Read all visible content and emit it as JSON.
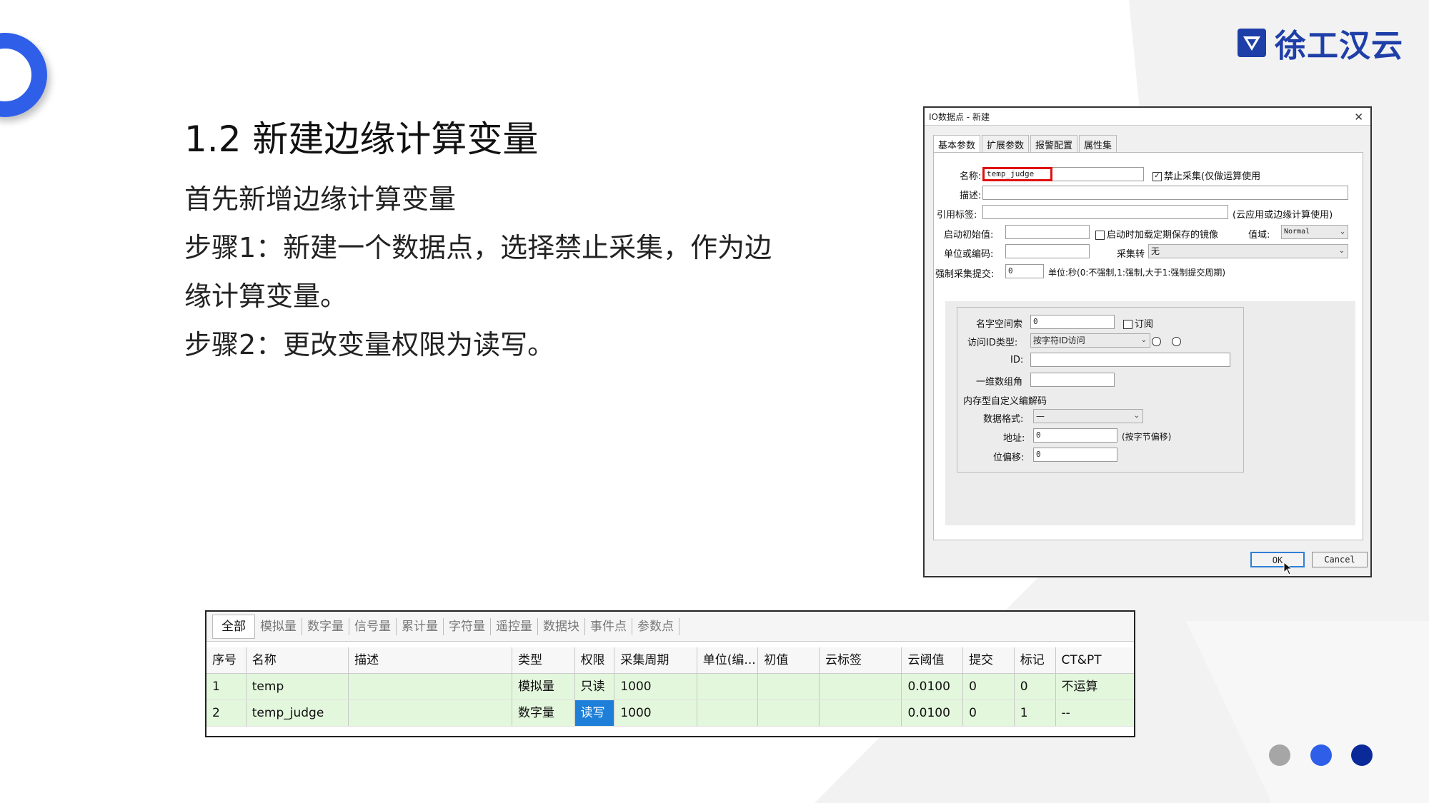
{
  "brand": {
    "logo_text": "徐工汉云",
    "accent": "#2f5fe8",
    "logo_color": "#1f3fa8"
  },
  "slide": {
    "title": "1.2 新建边缘计算变量",
    "lines": [
      "首先新增边缘计算变量",
      "步骤1：新建一个数据点，选择禁止采集，作为边",
      "缘计算变量。",
      "步骤2：更改变量权限为读写。"
    ]
  },
  "dialog": {
    "title": "IO数据点 - 新建",
    "tabs": [
      "基本参数",
      "扩展参数",
      "报警配置",
      "属性集"
    ],
    "fields": {
      "name_label": "名称:",
      "name_value": "temp_judge",
      "forbid_collect": "禁止采集(仅做运算使用",
      "desc_label": "描述:",
      "ref_tag_label": "引用标签:",
      "ref_tag_hint": "(云应用或边缘计算使用)",
      "init_value_label": "启动初始值:",
      "load_image_label": "启动时加载定期保存的镜像",
      "range_label": "值域:",
      "range_value": "Normal",
      "unit_label": "单位或编码:",
      "collect_convert_label": "采集转",
      "collect_convert_value": "无",
      "force_label": "强制采集提交:",
      "force_value": "0",
      "force_hint": "单位:秒(0:不强制,1:强制,大于1:强制提交周期)",
      "ns_index_label": "名字空间索",
      "ns_index_value": "0",
      "subscribe_label": "订阅",
      "access_type_label": "访问ID类型:",
      "access_type_value": "按字符ID访问",
      "id_label": "ID:",
      "array_label": "一维数组角",
      "custom_codec_label": "内存型自定义编解码",
      "data_format_label": "数据格式:",
      "data_format_value": "—",
      "address_label": "地址:",
      "address_value": "0",
      "address_hint": "(按字节偏移)",
      "bit_offset_label": "位偏移:",
      "bit_offset_value": "0"
    },
    "ok": "OK",
    "cancel": "Cancel",
    "close": "✕"
  },
  "table": {
    "tabs": [
      "全部",
      "模拟量",
      "数字量",
      "信号量",
      "累计量",
      "字符量",
      "遥控量",
      "数据块",
      "事件点",
      "参数点"
    ],
    "columns": [
      "序号",
      "名称",
      "描述",
      "类型",
      "权限",
      "采集周期",
      "单位(编...",
      "初值",
      "云标签",
      "云阈值",
      "提交",
      "标记",
      "CT&PT"
    ],
    "rows": [
      [
        "1",
        "temp",
        "",
        "模拟量",
        "只读",
        "1000",
        "",
        "",
        "",
        "0.0100",
        "0",
        "0",
        "不运算"
      ],
      [
        "2",
        "temp_judge",
        "",
        "数字量",
        "读写",
        "1000",
        "",
        "",
        "",
        "0.0100",
        "0",
        "1",
        "--"
      ]
    ]
  },
  "pager_dots": [
    {
      "color": "#a6a6a6"
    },
    {
      "color": "#2f5fe8"
    },
    {
      "color": "#0a2a9a"
    }
  ]
}
